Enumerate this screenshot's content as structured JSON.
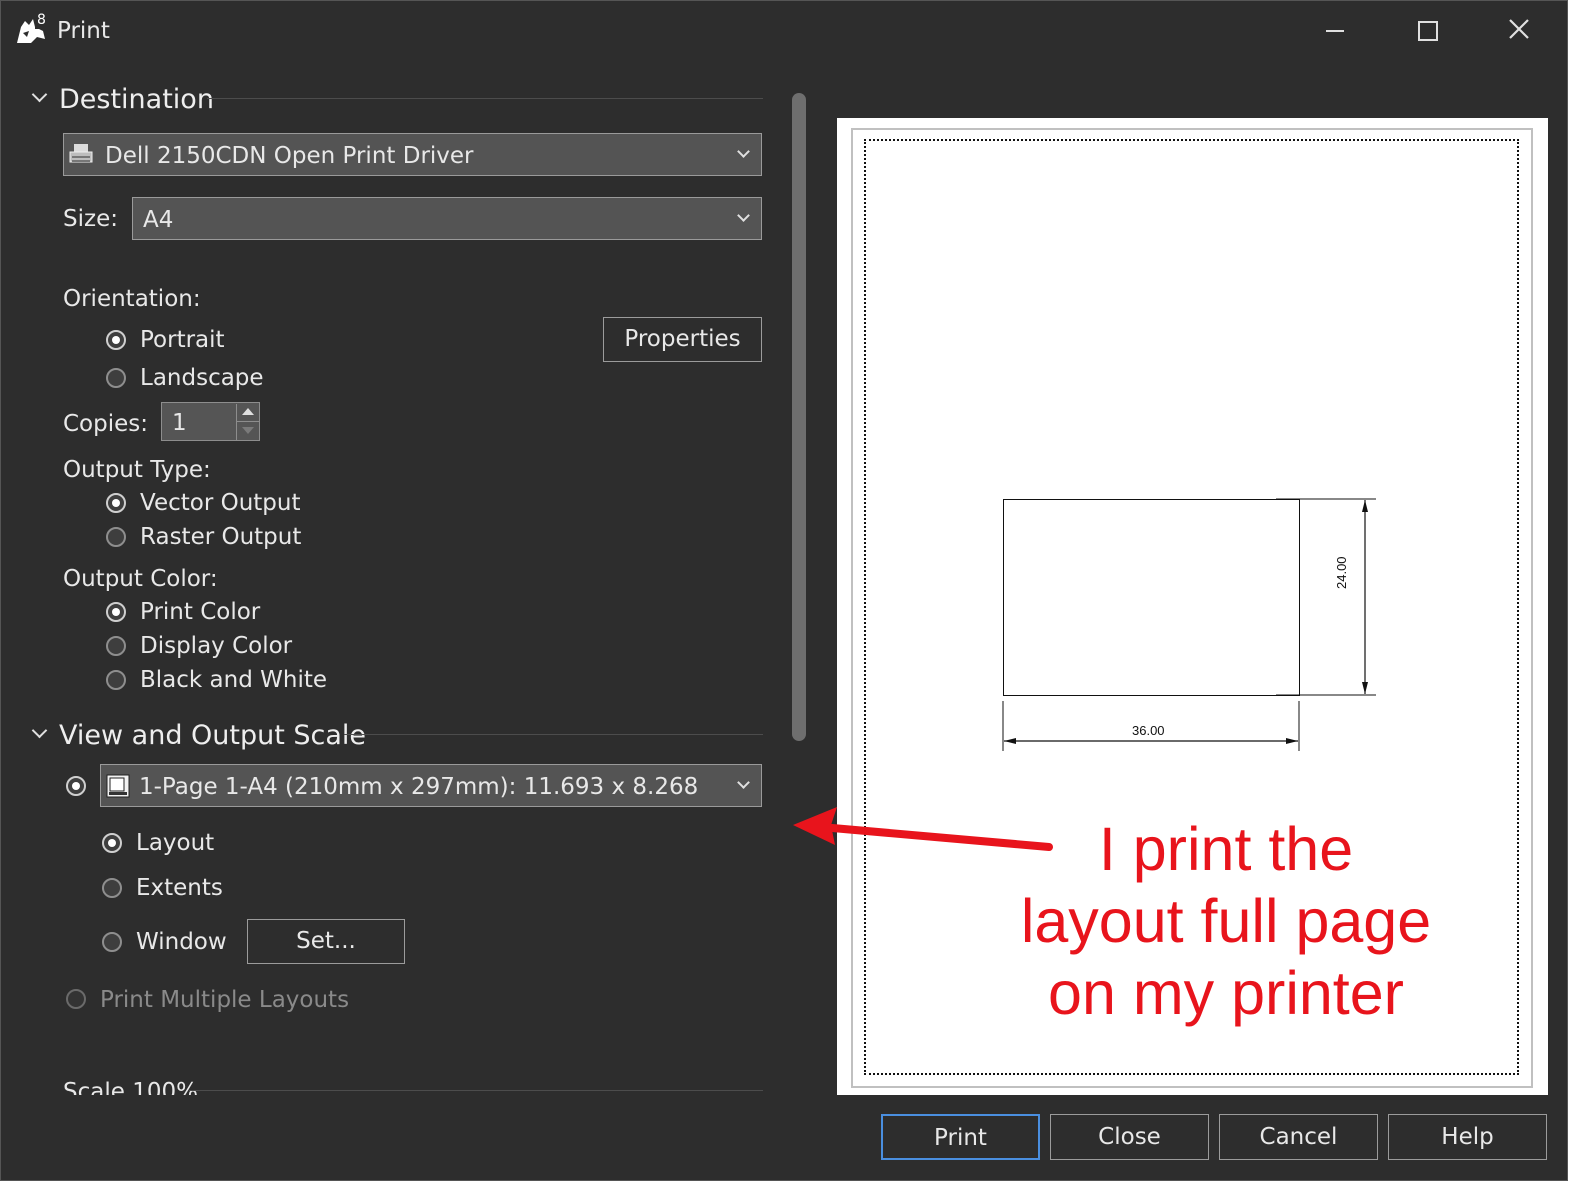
{
  "window": {
    "title": "Print",
    "app_icon_badge": "8"
  },
  "destination": {
    "header": "Destination",
    "printer": "Dell 2150CDN Open Print Driver",
    "size_label": "Size:",
    "size_value": "A4",
    "orientation_label": "Orientation:",
    "orientation_options": [
      "Portrait",
      "Landscape"
    ],
    "orientation_selected": "Portrait",
    "properties_button": "Properties",
    "copies_label": "Copies:",
    "copies_value": "1",
    "output_type_label": "Output Type:",
    "output_type_options": [
      "Vector Output",
      "Raster Output"
    ],
    "output_type_selected": "Vector Output",
    "output_color_label": "Output Color:",
    "output_color_options": [
      "Print Color",
      "Display Color",
      "Black and White"
    ],
    "output_color_selected": "Print Color"
  },
  "view_scale": {
    "header": "View and Output Scale",
    "layout_value": "1-Page 1-A4 (210mm x 297mm): 11.693 x 8.268",
    "area_options": [
      "Layout",
      "Extents",
      "Window"
    ],
    "area_selected": "Layout",
    "set_button": "Set...",
    "multiple_layouts": "Print Multiple Layouts",
    "scale_header_partial": "Scale 100%"
  },
  "preview": {
    "dim_horizontal": "36.00",
    "dim_vertical": "24.00"
  },
  "annotation": {
    "lines": [
      "I print the",
      "layout full page",
      "on my printer"
    ],
    "color": "#e8141c"
  },
  "footer": {
    "print": "Print",
    "close": "Close",
    "cancel": "Cancel",
    "help": "Help"
  }
}
